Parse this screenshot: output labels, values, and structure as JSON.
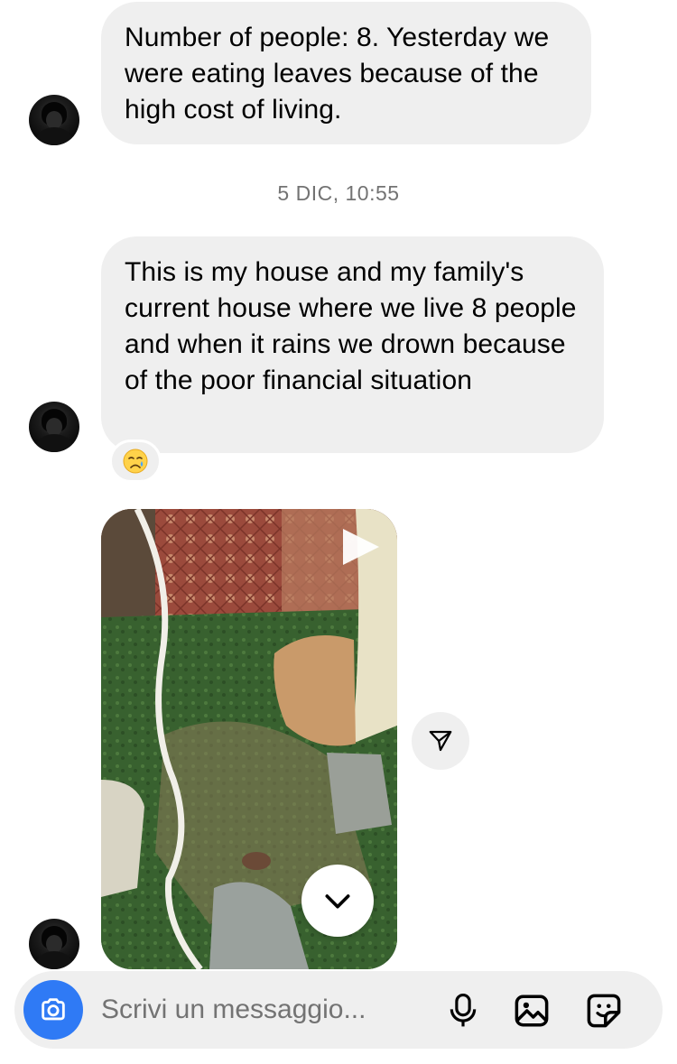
{
  "thread": {
    "messages": [
      {
        "text": "Number of people: 8. Yesterday we were eating leaves because of the high cost of living."
      },
      {
        "text": "This is my house and my family's current house where we live 8 people and when it rains we drown because of the poor financial situation",
        "reaction": "😢"
      }
    ],
    "timestamp": "5 DIC, 10:55"
  },
  "composer": {
    "placeholder": "Scrivi un messaggio..."
  },
  "icons": {
    "camera": "camera-icon",
    "mic": "microphone-icon",
    "gallery": "image-icon",
    "sticker": "sticker-icon",
    "share": "send-icon",
    "play": "play-icon",
    "scroll": "chevron-down-icon"
  },
  "colors": {
    "bubble": "#efefef",
    "accent": "#2f7af5",
    "muted": "#737373"
  }
}
